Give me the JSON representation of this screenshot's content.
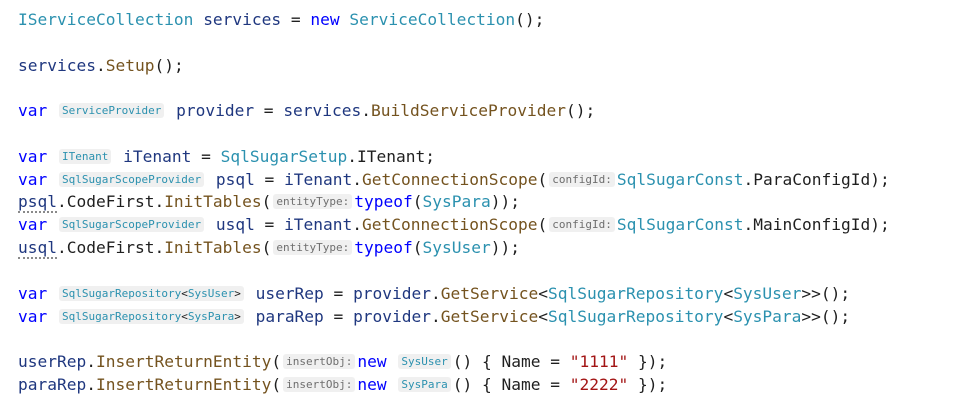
{
  "code": {
    "l1": {
      "t1": "IServiceCollection",
      "v1": "services",
      "p1": " = ",
      "kw1": "new",
      "t2": "ServiceCollection",
      "p2": "();"
    },
    "l2": {
      "v1": "services",
      "p1": ".",
      "f1": "Setup",
      "p2": "();"
    },
    "l3": {
      "kw1": "var",
      "h1": "ServiceProvider",
      "v1": "provider",
      "p1": " = ",
      "v2": "services",
      "p2": ".",
      "f1": "BuildServiceProvider",
      "p3": "();"
    },
    "l4": {
      "kw1": "var",
      "h1": "ITenant",
      "v1": "iTenant",
      "p1": " = ",
      "t1": "SqlSugarSetup",
      "p2": ".ITenant;"
    },
    "l5": {
      "kw1": "var",
      "h1": "SqlSugarScopeProvider",
      "v1": "psql",
      "p1": " = ",
      "v2": "iTenant",
      "p2": ".",
      "f1": "GetConnectionScope",
      "p3": "(",
      "h2": "configId:",
      "t1": "SqlSugarConst",
      "p4": ".ParaConfigId);"
    },
    "l6": {
      "v1": "psql",
      "p1": ".CodeFirst.",
      "f1": "InitTables",
      "p2": "(",
      "h1": "entityType:",
      "kw1": "typeof",
      "p3": "(",
      "t1": "SysPara",
      "p4": "));"
    },
    "l7": {
      "kw1": "var",
      "h1": "SqlSugarScopeProvider",
      "v1": "usql",
      "p1": " = ",
      "v2": "iTenant",
      "p2": ".",
      "f1": "GetConnectionScope",
      "p3": "(",
      "h2": "configId:",
      "t1": "SqlSugarConst",
      "p4": ".MainConfigId);"
    },
    "l8": {
      "v1": "usql",
      "p1": ".CodeFirst.",
      "f1": "InitTables",
      "p2": "(",
      "h1": "entityType:",
      "kw1": "typeof",
      "p3": "(",
      "t1": "SysUser",
      "p4": "));"
    },
    "l9": {
      "kw1": "var",
      "h1a": "SqlSugarRepository",
      "h1b": "<",
      "h1c": "SysUser",
      "h1d": ">",
      "v1": "userRep",
      "p1": " = ",
      "v2": "provider",
      "p2": ".",
      "f1": "GetService",
      "p3": "<",
      "t1": "SqlSugarRepository",
      "p4": "<",
      "t2": "SysUser",
      "p5": ">>();"
    },
    "l10": {
      "kw1": "var",
      "h1a": "SqlSugarRepository",
      "h1b": "<",
      "h1c": "SysPara",
      "h1d": ">",
      "v1": "paraRep",
      "p1": " = ",
      "v2": "provider",
      "p2": ".",
      "f1": "GetService",
      "p3": "<",
      "t1": "SqlSugarRepository",
      "p4": "<",
      "t2": "SysPara",
      "p5": ">>();"
    },
    "l11": {
      "v1": "userRep",
      "p1": ".",
      "f1": "InsertReturnEntity",
      "p2": "(",
      "h1": "insertObj:",
      "kw1": "new",
      "h2": "SysUser",
      "p3": "() { Name = ",
      "s1": "\"1111\"",
      "p4": " });"
    },
    "l12": {
      "v1": "paraRep",
      "p1": ".",
      "f1": "InsertReturnEntity",
      "p2": "(",
      "h1": "insertObj:",
      "kw1": "new",
      "h2": "SysPara",
      "p3": "() { Name = ",
      "s1": "\"2222\"",
      "p4": " });"
    }
  },
  "colors": {
    "keyword": "#0000ff",
    "type": "#2b91af",
    "method": "#74531f",
    "string": "#a31515",
    "identifier": "#1f377f",
    "inlay_hint_bg": "#f0f0f0"
  }
}
